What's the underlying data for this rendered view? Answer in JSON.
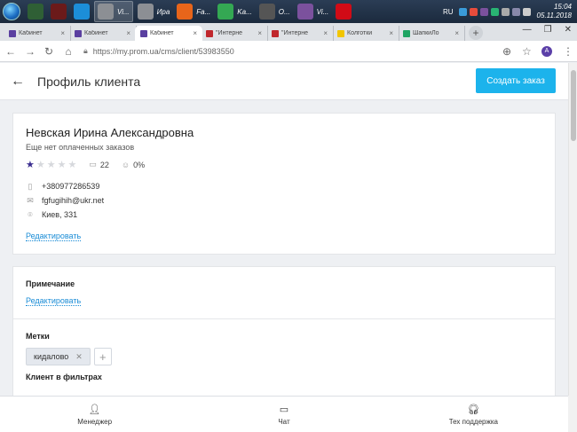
{
  "taskbar": {
    "items": [
      {
        "label": "",
        "color": "#2f5f35",
        "active": false
      },
      {
        "label": "",
        "color": "#6b1a1a",
        "active": false
      },
      {
        "label": "",
        "color": "#1c8ed8",
        "active": false
      },
      {
        "label": "Vi...",
        "color": "#8c8f94",
        "active": true
      },
      {
        "label": "Ира",
        "color": "#8c8f94",
        "active": false
      },
      {
        "label": "Fa...",
        "color": "#e8651a",
        "active": false
      },
      {
        "label": "Ka...",
        "color": "#34a853",
        "active": false
      },
      {
        "label": "O...",
        "color": "#555555",
        "active": false
      },
      {
        "label": "Vi...",
        "color": "#7b519d",
        "active": false
      },
      {
        "label": "",
        "color": "#d10b16",
        "active": false
      }
    ],
    "lang": "RU",
    "time": "15:04",
    "date": "05.11.2018"
  },
  "tabs": [
    {
      "label": "Кабинет",
      "color": "#5a3fa0",
      "active": false
    },
    {
      "label": "Кабинет",
      "color": "#5a3fa0",
      "active": false
    },
    {
      "label": "Кабинет",
      "color": "#5a3fa0",
      "active": true
    },
    {
      "label": "\"Интерне",
      "color": "#c0272d",
      "active": false
    },
    {
      "label": "\"Интерне",
      "color": "#c0272d",
      "active": false
    },
    {
      "label": "Колготки",
      "color": "#f2c500",
      "active": false
    },
    {
      "label": "ШапкиЛо",
      "color": "#1fa463",
      "active": false
    }
  ],
  "browser": {
    "url": "https://my.prom.ua/cms/client/53983550",
    "avatar_letter": "A",
    "tab_close": "×",
    "new_tab": "+"
  },
  "header": {
    "title": "Профиль клиента",
    "create_button": "Создать заказ"
  },
  "client": {
    "name": "Невская Ирина Александровна",
    "status": "Еще нет оплаченных заказов",
    "rating": 1,
    "max_rating": 5,
    "comments_count": "22",
    "percent": "0%",
    "phone": "+380977286539",
    "email": "fgfugihih@ukr.net",
    "address": "Киев, 331",
    "edit_link": "Редактировать"
  },
  "note": {
    "title": "Примечание",
    "edit_link": "Редактировать"
  },
  "tags": {
    "title": "Метки",
    "items": [
      "кидалово"
    ]
  },
  "filters": {
    "title": "Клиент в фильтрах"
  },
  "bottom_nav": [
    {
      "label": "Менеджер",
      "icon": "person-icon"
    },
    {
      "label": "Чат",
      "icon": "chat-icon"
    },
    {
      "label": "Тех поддержка",
      "icon": "headset-icon"
    }
  ]
}
